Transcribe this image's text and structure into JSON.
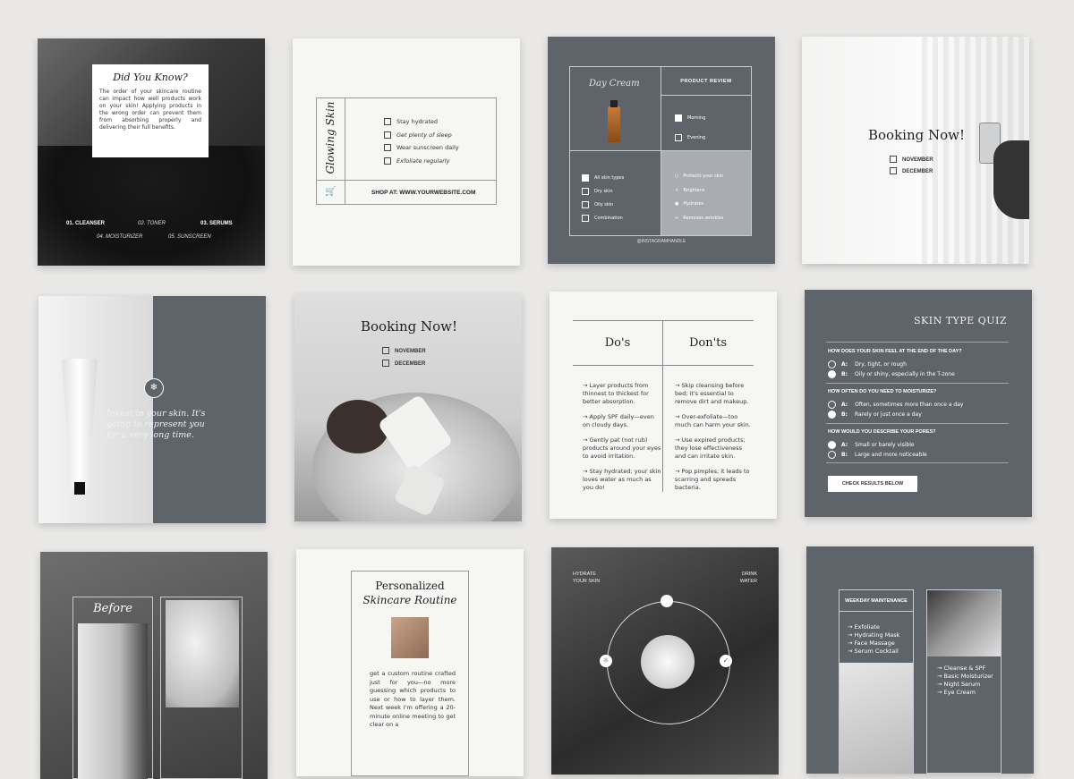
{
  "c1": {
    "title": "Did You Know?",
    "body": "The order of your skincare routine can impact how well products work on your skin! Applying products in the wrong order can prevent them from absorbing properly and delivering their full benefits.",
    "steps": [
      "01. CLEANSER",
      "02. TONER",
      "03. SERUMS",
      "04. MOISTURIZER",
      "05. SUNSCREEN"
    ]
  },
  "c2": {
    "title": "Glowing Skin",
    "items": [
      "Stay hydrated",
      "Get plenty of sleep",
      "Wear sunscreen daily",
      "Exfoliate regularly"
    ],
    "shop": "SHOP AT: WWW.YOURWEBSITE.COM"
  },
  "c3": {
    "title": "Day Cream",
    "header": "PRODUCT REVIEW",
    "times": [
      "Morning",
      "Evening"
    ],
    "types": [
      "All skin types",
      "Dry skin",
      "Oily skin",
      "Combination"
    ],
    "benefits": [
      "Protects your skin",
      "Brightens",
      "Hydrates",
      "Removes wrinkles"
    ],
    "handle": "@INSTAGRAMHANDLE"
  },
  "c4": {
    "title": "Booking Now!",
    "months": [
      "NOVEMBER",
      "DECEMBER"
    ]
  },
  "c5": {
    "quote": "Invest in your skin. It's going to represent you for a very long time."
  },
  "c6": {
    "title": "Booking Now!",
    "months": [
      "NOVEMBER",
      "DECEMBER"
    ]
  },
  "c7": {
    "dos_title": "Do's",
    "donts_title": "Don'ts",
    "dos": [
      "→ Layer products from thinnest to thickest for better absorption.",
      "→ Apply SPF daily—even on cloudy days.",
      "→ Gently pat (not rub) products around your eyes to avoid irritation.",
      "→ Stay hydrated; your skin loves water as much as you do!"
    ],
    "donts": [
      "→ Skip cleansing before bed; it's essential to remove dirt and makeup.",
      "→ Over-exfoliate—too much can harm your skin.",
      "→ Use expired products; they lose effectiveness and can irritate skin.",
      "→ Pop pimples; it leads to scarring and spreads bacteria."
    ]
  },
  "c8": {
    "title": "SKIN TYPE QUIZ",
    "questions": [
      {
        "q": "HOW DOES YOUR SKIN FEEL AT THE END OF THE DAY?",
        "a": "Dry, tight, or rough",
        "b": "Oily or shiny, especially in the T-zone"
      },
      {
        "q": "HOW OFTEN DO YOU NEED TO MOISTURIZE?",
        "a": "Often, sometimes more than once a day",
        "b": "Rarely or just once a day"
      },
      {
        "q": "HOW WOULD YOU DESCRIBE YOUR PORES?",
        "a": "Small or barely visible",
        "b": "Large and more noticeable"
      }
    ],
    "letters": [
      "A:",
      "B:"
    ],
    "button": "CHECK RESULTS BELOW"
  },
  "c9": {
    "label": "Before"
  },
  "c10": {
    "title1": "Personalized",
    "title2": "Skincare Routine",
    "body": "get a custom routine crafted just for you—no more guessing which products to use or how to layer them. Next week I'm offering a 20-minute online meeting to get clear on a"
  },
  "c11": {
    "left": "HYDRATE YOUR SKIN",
    "right": "DRINK WATER"
  },
  "c12": {
    "header": "WEEKDAY MAINTENANCE",
    "list1": [
      "→ Exfoliate",
      "→ Hydrating Mask",
      "→ Face Massage",
      "→ Serum Cocktail"
    ],
    "list2": [
      "→ Cleanse & SPF",
      "→ Basic Moisturizer",
      "→ Night Serum",
      "→ Eye Cream"
    ]
  },
  "colors": {
    "slate": "#5f646b",
    "paper": "#f6f6f5",
    "background": "#e9e8e6"
  }
}
